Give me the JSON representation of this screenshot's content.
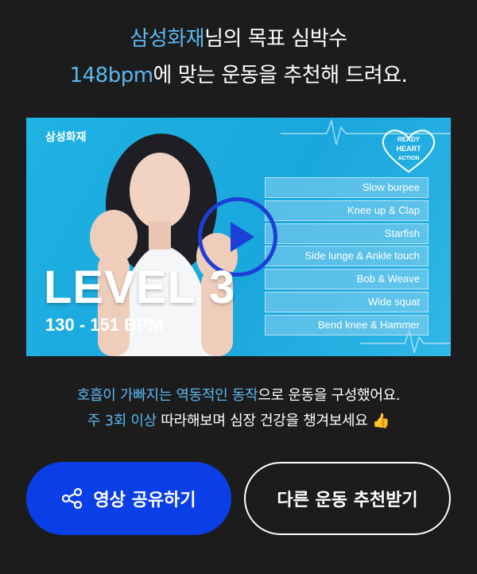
{
  "headline": {
    "line1_highlight": "삼성화재",
    "line1_rest": "님의 목표 심박수",
    "line2_highlight": "148bpm",
    "line2_rest": "에 맞는 운동을 추천해 드려요."
  },
  "video": {
    "brand": "삼성화재",
    "badge_text": "READY HEART ACTION",
    "level": "LEVEL 3",
    "bpm_range": "130 - 151 BPM",
    "moves": [
      "Slow burpee",
      "Knee up & Clap",
      "Starfish",
      "Side lunge & Ankle touch",
      "Bob & Weave",
      "Wide squat",
      "Bend knee & Hammer"
    ]
  },
  "description": {
    "line1_highlight": "호흡이 가빠지는 역동적인 동작",
    "line1_rest": "으로 운동을 구성했어요.",
    "line2_highlight": "주 3회 이상",
    "line2_rest": " 따라해보며 심장 건강을 챙겨보세요 ",
    "emoji": "👍"
  },
  "buttons": {
    "share_label": "영상 공유하기",
    "other_label": "다른 운동 추천받기"
  },
  "colors": {
    "background": "#1c1c1c",
    "accent": "#5ab8f0",
    "primary_button": "#0a3ee6",
    "video_bg": "#1fb2e3"
  }
}
